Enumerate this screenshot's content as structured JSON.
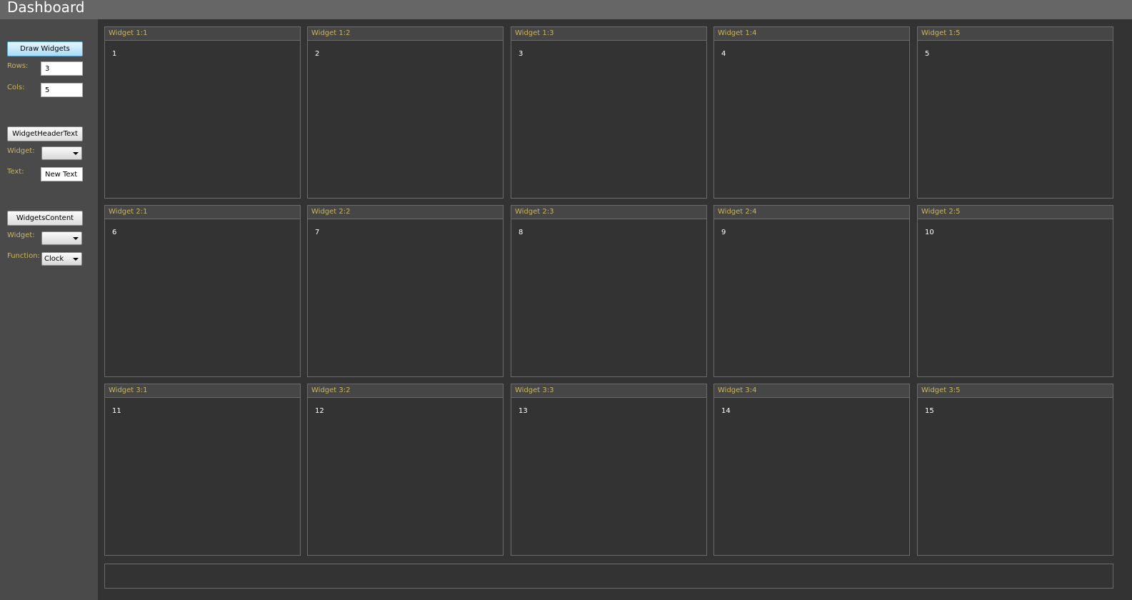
{
  "app": {
    "title": "Dashboard"
  },
  "sidebar": {
    "draw_section": {
      "button_label": "Draw Widgets",
      "rows_label": "Rows:",
      "rows_value": "3",
      "cols_label": "Cols:",
      "cols_value": "5"
    },
    "header_text_section": {
      "button_label": "WidgetHeaderText",
      "widget_label": "Widget:",
      "widget_value": "",
      "text_label": "Text:",
      "text_value": "New Text"
    },
    "content_section": {
      "button_label": "WidgetsContent",
      "widget_label": "Widget:",
      "widget_value": "",
      "function_label": "Function:",
      "function_value": "Clock"
    }
  },
  "widgets": [
    {
      "title": "Widget 1:1",
      "content": "1"
    },
    {
      "title": "Widget 1:2",
      "content": "2"
    },
    {
      "title": "Widget 1:3",
      "content": "3"
    },
    {
      "title": "Widget 1:4",
      "content": "4"
    },
    {
      "title": "Widget 1:5",
      "content": "5"
    },
    {
      "title": "Widget 2:1",
      "content": "6"
    },
    {
      "title": "Widget 2:2",
      "content": "7"
    },
    {
      "title": "Widget 2:3",
      "content": "8"
    },
    {
      "title": "Widget 2:4",
      "content": "9"
    },
    {
      "title": "Widget 2:5",
      "content": "10"
    },
    {
      "title": "Widget 3:1",
      "content": "11"
    },
    {
      "title": "Widget 3:2",
      "content": "12"
    },
    {
      "title": "Widget 3:3",
      "content": "13"
    },
    {
      "title": "Widget 3:4",
      "content": "14"
    },
    {
      "title": "Widget 3:5",
      "content": "15"
    }
  ],
  "colors": {
    "header_text": "#c8b560",
    "background": "#333333",
    "sidebar": "#4a4a4a",
    "titlebar": "#666666"
  }
}
